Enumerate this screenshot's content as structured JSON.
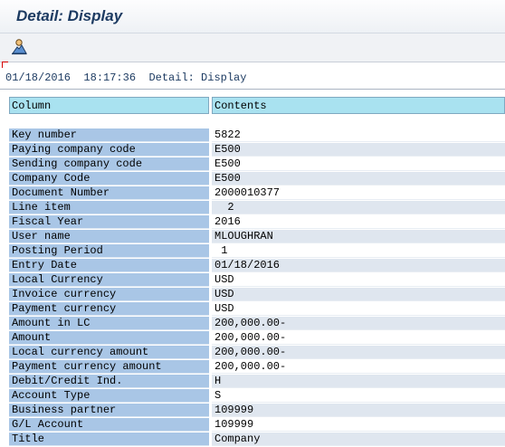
{
  "window": {
    "title": "Detail: Display"
  },
  "toolbar": {
    "icon": "user-mountain-icon"
  },
  "status": {
    "date": "01/18/2016",
    "time": "18:17:36",
    "screen": "Detail: Display"
  },
  "table": {
    "headers": [
      "Column",
      "Contents"
    ],
    "rows": [
      {
        "label": "Key number",
        "value": "5822"
      },
      {
        "label": "Paying company code",
        "value": "E500"
      },
      {
        "label": "Sending company code",
        "value": "E500"
      },
      {
        "label": "Company Code",
        "value": "E500"
      },
      {
        "label": "Document Number",
        "value": "2000010377"
      },
      {
        "label": "Line item",
        "value": "  2"
      },
      {
        "label": "Fiscal Year",
        "value": "2016"
      },
      {
        "label": "User name",
        "value": "MLOUGHRAN"
      },
      {
        "label": "Posting Period",
        "value": " 1"
      },
      {
        "label": "Entry Date",
        "value": "01/18/2016"
      },
      {
        "label": "Local Currency",
        "value": "USD"
      },
      {
        "label": "Invoice currency",
        "value": "USD"
      },
      {
        "label": "Payment currency",
        "value": "USD"
      },
      {
        "label": "Amount in LC",
        "value": "200,000.00-"
      },
      {
        "label": "Amount",
        "value": "200,000.00-"
      },
      {
        "label": "Local currency amount",
        "value": "200,000.00-"
      },
      {
        "label": "Payment currency amount",
        "value": "200,000.00-"
      },
      {
        "label": "Debit/Credit Ind.",
        "value": "H"
      },
      {
        "label": "Account Type",
        "value": "S"
      },
      {
        "label": "Business partner",
        "value": "109999"
      },
      {
        "label": "G/L Account",
        "value": "109999"
      },
      {
        "label": "Title",
        "value": "Company"
      }
    ]
  }
}
